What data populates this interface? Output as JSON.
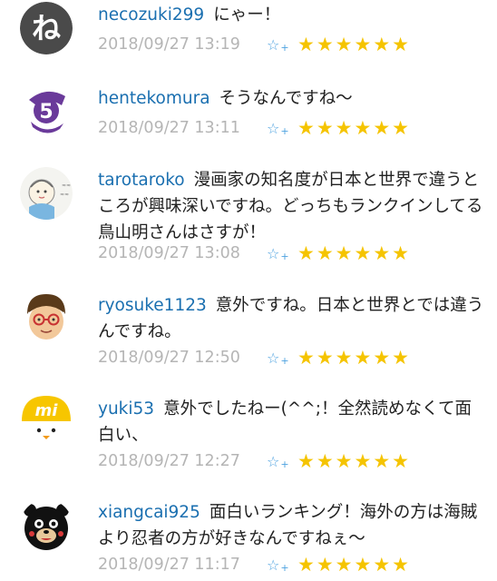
{
  "comments": [
    {
      "user": "necozuki299",
      "text": "にゃー！",
      "time": "2018/09/27 13:19",
      "add_star_icon": "add-star-icon",
      "star_count": 6,
      "avatar_icon": "cat-character-avatar",
      "avatar_colors": [
        "#4a4a4a",
        "#ffffff"
      ]
    },
    {
      "user": "hentekomura",
      "text": "そうなんですね～",
      "time": "2018/09/27 13:11",
      "add_star_icon": "add-star-icon",
      "star_count": 6,
      "avatar_icon": "purple-number-avatar",
      "avatar_colors": [
        "#6a3a9a",
        "#ffffff"
      ]
    },
    {
      "user": "tarotaroko",
      "text": "漫画家の知名度が日本と世界で違うところが興味深いですね。どっちもランクインしてる鳥山明さんはさすが！",
      "time": "2018/09/27 13:08",
      "add_star_icon": "add-star-icon",
      "star_count": 6,
      "avatar_icon": "child-drawing-avatar",
      "avatar_colors": [
        "#f4f4f0",
        "#7ab6e0"
      ]
    },
    {
      "user": "ryosuke1123",
      "text": "意外ですね。日本と世界とでは違うんですね。",
      "time": "2018/09/27 12:50",
      "add_star_icon": "add-star-icon",
      "star_count": 6,
      "avatar_icon": "man-with-glasses-avatar",
      "avatar_colors": [
        "#5a3a1a",
        "#f2c89a"
      ]
    },
    {
      "user": "yuki53",
      "text": "意外でしたねー(^^;！全然読めなくて面白い、",
      "time": "2018/09/27 12:27",
      "add_star_icon": "add-star-icon",
      "star_count": 6,
      "avatar_icon": "yellow-bird-avatar",
      "avatar_colors": [
        "#f7c600",
        "#ffffff"
      ]
    },
    {
      "user": "xiangcai925",
      "text": "面白いランキング！海外の方は海賊より忍者の方が好きなんですねぇ～",
      "time": "2018/09/27 11:17",
      "add_star_icon": "add-star-icon",
      "star_count": 6,
      "avatar_icon": "black-bear-avatar",
      "avatar_colors": [
        "#111111",
        "#e8c89a"
      ]
    }
  ],
  "colors": {
    "username": "#1a6fb0",
    "timestamp": "#b5b5b5",
    "star": "#f5c400",
    "add_star": "#4fa3e0"
  }
}
